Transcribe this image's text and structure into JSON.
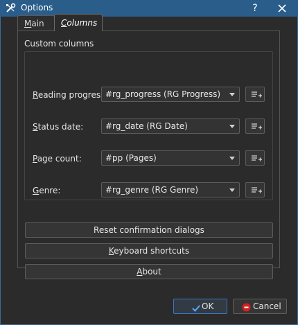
{
  "window": {
    "title": "Options",
    "help_label": "?",
    "accent_color": "#2a5d8a"
  },
  "tabs": [
    {
      "label_prefix": "",
      "label_ul": "M",
      "label_rest": "ain",
      "active": false
    },
    {
      "label_prefix": "",
      "label_ul": "C",
      "label_rest": "olumns",
      "active": true
    }
  ],
  "custom_columns": {
    "group_title": "Custom columns",
    "rows": [
      {
        "label_ul": "R",
        "label_rest": "eading progress:",
        "value": "#rg_progress (RG Progress)"
      },
      {
        "label_ul": "S",
        "label_rest": "tatus date:",
        "value": "#rg_date (RG Date)"
      },
      {
        "label_ul": "P",
        "label_rest": "age count:",
        "value": "#pp (Pages)"
      },
      {
        "label_ul": "G",
        "label_rest": "enre:",
        "value": "#rg_genre (RG Genre)"
      }
    ],
    "edit_icon": "list-add-icon"
  },
  "buttons": {
    "reset": {
      "pre": "Reset confirmation dialo",
      "ul": "g",
      "post": "s"
    },
    "keyboard": {
      "pre": "",
      "ul": "K",
      "post": "eyboard shortcuts"
    },
    "about": {
      "pre": "",
      "ul": "A",
      "post": "bout"
    },
    "ok": "OK",
    "cancel": "Cancel"
  },
  "icons": {
    "app": "tools-icon",
    "close": "close-icon",
    "ok": "checkmark-icon",
    "cancel": "stop-icon"
  }
}
